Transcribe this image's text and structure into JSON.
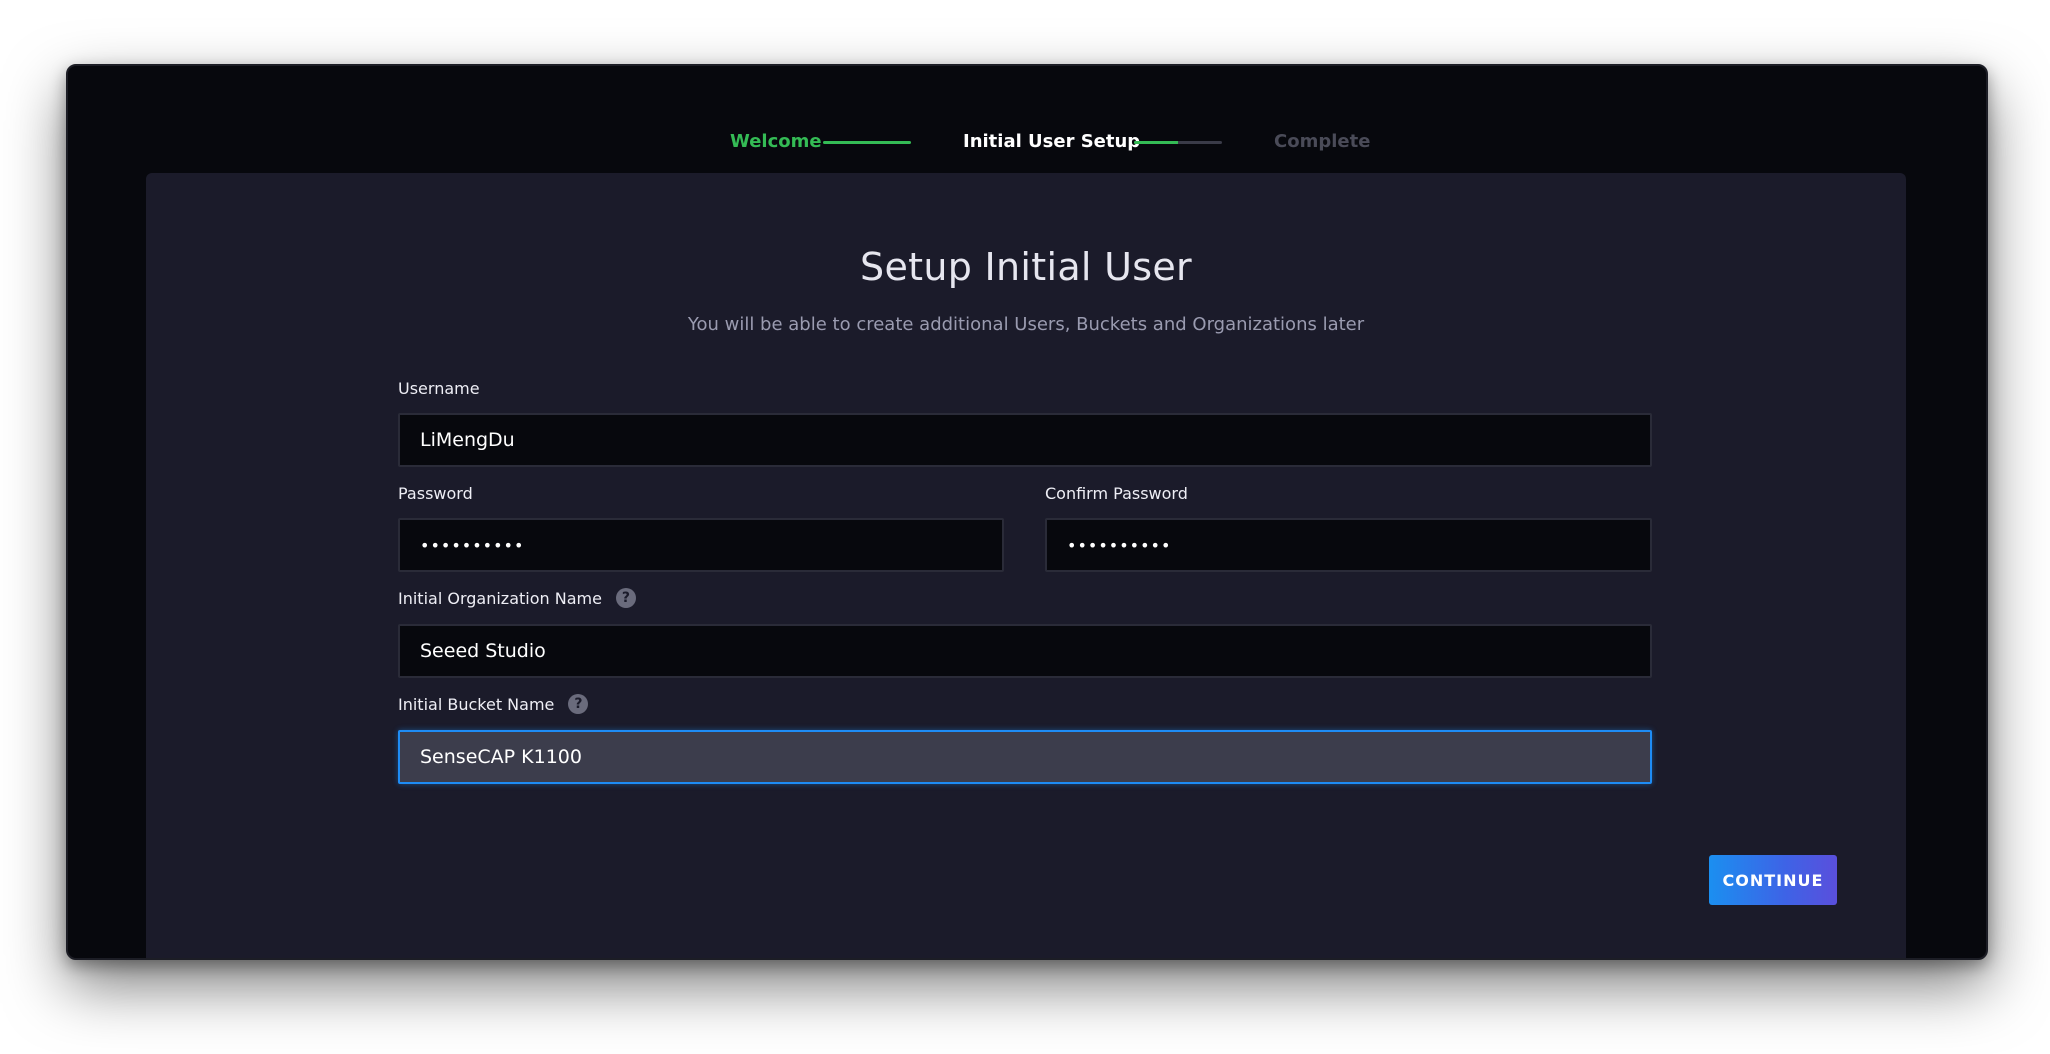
{
  "stepper": {
    "steps": [
      {
        "label": "Welcome",
        "state": "complete"
      },
      {
        "label": "Initial User Setup",
        "state": "current"
      },
      {
        "label": "Complete",
        "state": "upcoming"
      }
    ],
    "progress_setup_fraction": 0.5
  },
  "page": {
    "title": "Setup Initial User",
    "subtitle": "You will be able to create additional Users, Buckets and Organizations later"
  },
  "form": {
    "username": {
      "label": "Username",
      "value": "LiMengDu"
    },
    "password": {
      "label": "Password",
      "value": "••••••••••"
    },
    "confirm_password": {
      "label": "Confirm Password",
      "value": "••••••••••"
    },
    "org": {
      "label": "Initial Organization Name",
      "value": "Seeed Studio",
      "help_icon": "question-circle-icon"
    },
    "bucket": {
      "label": "Initial Bucket Name",
      "value": "SenseCAP K1100",
      "help_icon": "question-circle-icon"
    }
  },
  "actions": {
    "continue_label": "CONTINUE"
  },
  "colors": {
    "accent_green": "#34bb55",
    "focus_blue": "#1e8cf5",
    "panel_bg": "#1b1b2a",
    "window_bg": "#07080d"
  }
}
